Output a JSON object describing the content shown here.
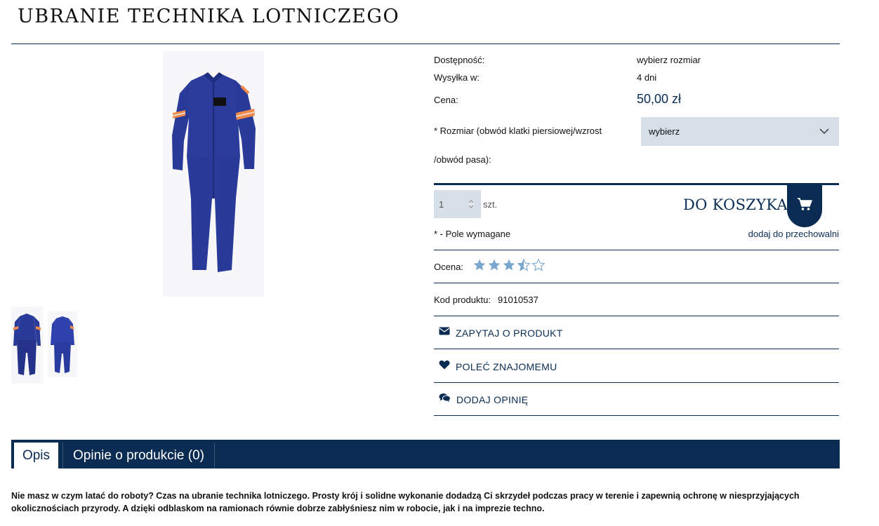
{
  "product": {
    "title": "UBRANIE TECHNIKA LOTNICZEGO",
    "availability_label": "Dostępność:",
    "availability_value": "wybierz rozmiar",
    "shipping_label": "Wysyłka w:",
    "shipping_value": "4 dni",
    "price_label": "Cena:",
    "price_value": "50,00 zł",
    "size_label": "* Rozmiar (obwód klatki piersiowej/wzrost /obwód pasa):",
    "size_selected": "wybierz",
    "quantity": "1",
    "quantity_unit": "szt.",
    "add_to_cart_label": "DO KOSZYKA",
    "required_note": "* - Pole wymagane",
    "wishlist_label": "dodaj do przechowalni",
    "rating_label": "Ocena:",
    "rating_value": 3.5,
    "rating_max": 5,
    "code_label": "Kod produktu:",
    "code_value": "91010537"
  },
  "actions": {
    "ask": "ZAPYTAJ O PRODUKT",
    "recommend": "POLEĆ ZNAJOMEMU",
    "review": "DODAJ OPINIĘ"
  },
  "tabs": [
    {
      "label": "Opis"
    },
    {
      "label": "Opinie o produkcie (0)"
    }
  ],
  "description": "Nie masz w czym latać do roboty? Czas na ubranie technika lotniczego. Prosty krój i solidne wykonanie dodadzą Ci skrzydeł podczas pracy w terenie i zapewnią ochronę w niesprzyjających okolicznościach przyrody. A dzięki odblaskom na ramionach równie dobrze zabłyśniesz nim w robocie, jak i na imprezie techno.",
  "colors": {
    "brand": "#0a2b52",
    "select_bg": "#d6dee7",
    "star": "#7aa6cf",
    "suit": "#2a3b9a",
    "reflective": "#f08a4b"
  }
}
